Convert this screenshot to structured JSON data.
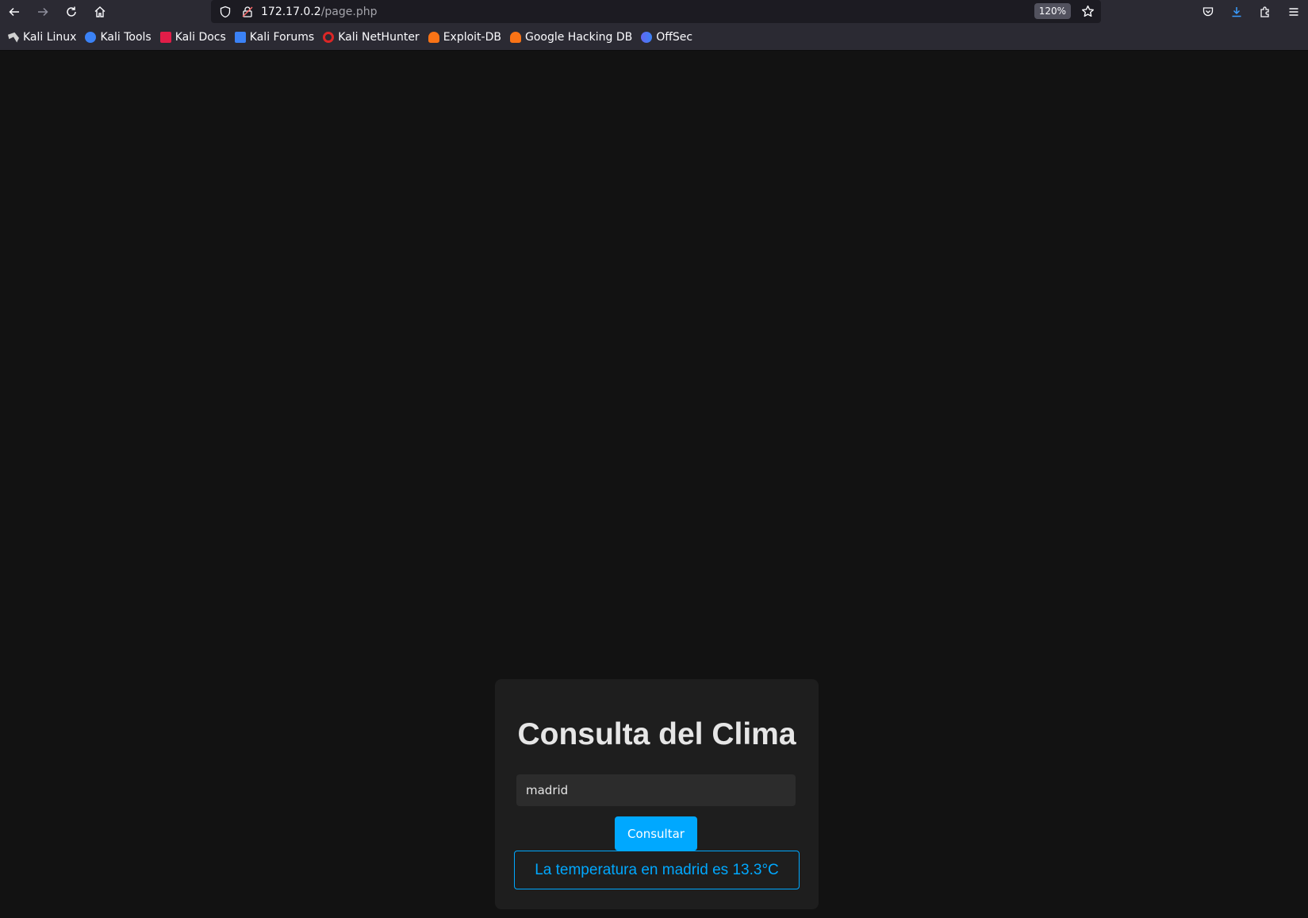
{
  "browser": {
    "url_host": "172.17.0.2",
    "url_path": "/page.php",
    "zoom": "120%",
    "bookmarks": [
      {
        "label": "Kali Linux",
        "icon": "kali-dragon-icon",
        "color": "#d0d0d0"
      },
      {
        "label": "Kali Tools",
        "icon": "kali-tools-icon",
        "color": "#3b82f6"
      },
      {
        "label": "Kali Docs",
        "icon": "kali-docs-icon",
        "color": "#e11d48"
      },
      {
        "label": "Kali Forums",
        "icon": "kali-forums-icon",
        "color": "#3b82f6"
      },
      {
        "label": "Kali NetHunter",
        "icon": "kali-nethunter-icon",
        "color": "#dc2626"
      },
      {
        "label": "Exploit-DB",
        "icon": "exploit-db-icon",
        "color": "#f97316"
      },
      {
        "label": "Google Hacking DB",
        "icon": "ghdb-icon",
        "color": "#f97316"
      },
      {
        "label": "OffSec",
        "icon": "offsec-icon",
        "color": "#6366f1"
      }
    ]
  },
  "page": {
    "title": "Consulta del Clima",
    "city_value": "madrid",
    "submit_label": "Consultar",
    "result_text": "La temperatura en madrid es 13.3°C",
    "accent_color": "#00a8ff"
  }
}
